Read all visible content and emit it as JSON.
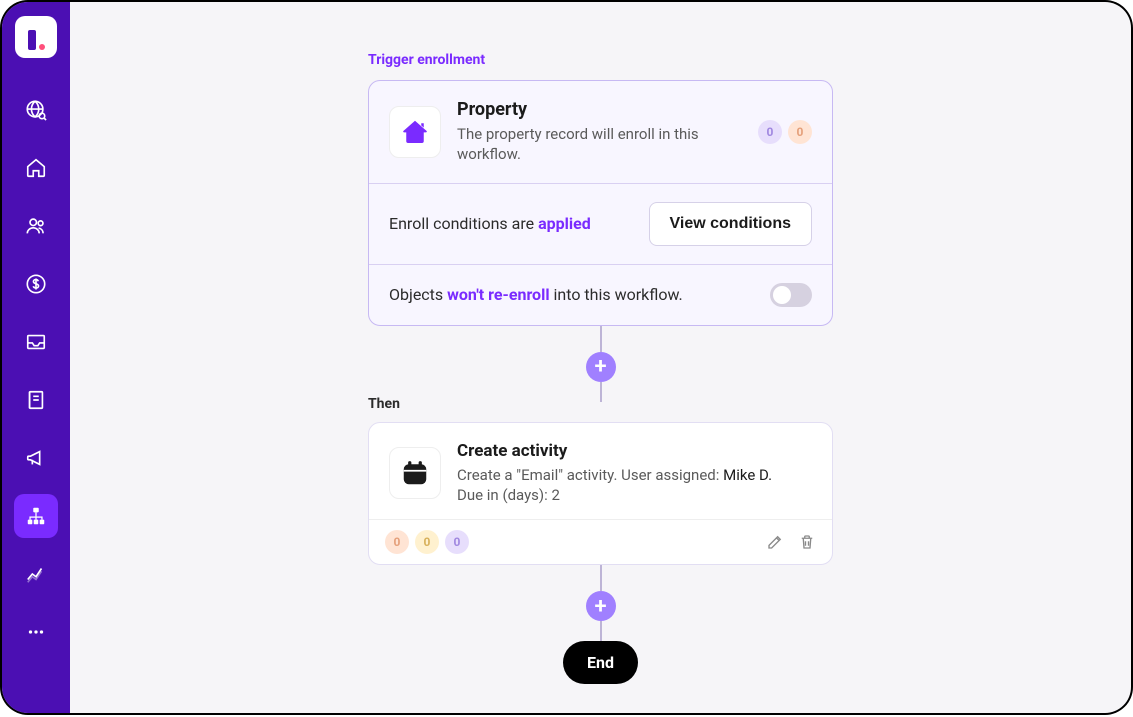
{
  "sidebar": {
    "items": [
      {
        "name": "globe"
      },
      {
        "name": "home"
      },
      {
        "name": "people"
      },
      {
        "name": "dollar"
      },
      {
        "name": "inbox"
      },
      {
        "name": "book"
      },
      {
        "name": "megaphone"
      },
      {
        "name": "workflow",
        "active": true
      },
      {
        "name": "chart"
      },
      {
        "name": "more"
      }
    ]
  },
  "trigger": {
    "section_label": "Trigger enrollment",
    "title": "Property",
    "subtitle": "The property record will enroll in this workflow.",
    "badges": [
      {
        "value": "0",
        "color": "purple"
      },
      {
        "value": "0",
        "color": "orange"
      }
    ],
    "conditions_text_prefix": "Enroll conditions are ",
    "conditions_accent": "applied",
    "view_button": "View conditions",
    "reenroll_prefix": "Objects ",
    "reenroll_accent": "won't re-enroll",
    "reenroll_suffix": " into this workflow."
  },
  "then": {
    "section_label": "Then",
    "title": "Create activity",
    "desc_line1_prefix": "Create a \"Email\" activity. User assigned: ",
    "desc_line1_user": "Mike D.",
    "desc_line2": "Due in (days): 2",
    "badges": [
      {
        "value": "0",
        "color": "orange"
      },
      {
        "value": "0",
        "color": "yellow"
      },
      {
        "value": "0",
        "color": "purple"
      }
    ]
  },
  "end_label": "End"
}
